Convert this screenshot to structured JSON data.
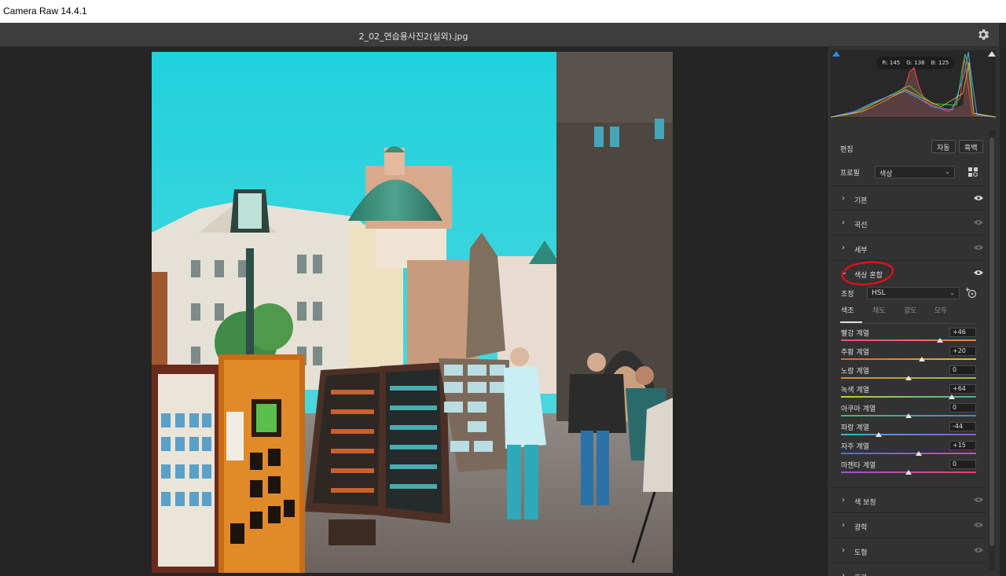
{
  "app": {
    "title": "Camera Raw 14.4.1"
  },
  "document": {
    "filename": "2_02_연습용사진2(실외).jpg"
  },
  "histogram": {
    "r": "R: 145",
    "g": "G: 136",
    "b": "B: 125"
  },
  "edit": {
    "title": "편집",
    "auto_label": "자동",
    "bw_label": "흑백",
    "profile_label": "프로필",
    "profile_value": "색상"
  },
  "sections": {
    "basic": "기본",
    "curve": "곡선",
    "detail": "세부",
    "color_mixer": "색상 혼합",
    "color_grading": "색 보정",
    "optics": "광학",
    "geometry": "도형",
    "effects": "효과"
  },
  "mixer": {
    "adjust_label": "조정",
    "adjust_value": "HSL",
    "tabs": [
      "색조",
      "채도",
      "광도",
      "모두"
    ],
    "active_tab": 0,
    "sliders": [
      {
        "label": "빨강 계열",
        "value": "+46",
        "level": 46,
        "color_from": "#e14d8c",
        "color_to": "#e58a3c"
      },
      {
        "label": "주황 계열",
        "value": "+20",
        "level": 20,
        "color_from": "#e25a3d",
        "color_to": "#d9c23b"
      },
      {
        "label": "노랑 계열",
        "value": "0",
        "level": 0,
        "color_from": "#d98a2e",
        "color_to": "#8fc23d"
      },
      {
        "label": "녹색 계열",
        "value": "+64",
        "level": 64,
        "color_from": "#c9c93a",
        "color_to": "#35b99a"
      },
      {
        "label": "아쿠아 계열",
        "value": "0",
        "level": 0,
        "color_from": "#3fbf62",
        "color_to": "#3a8ad6"
      },
      {
        "label": "파랑 계열",
        "value": "-44",
        "level": -44,
        "color_from": "#36b6c6",
        "color_to": "#8a56d6"
      },
      {
        "label": "자주 계열",
        "value": "+15",
        "level": 15,
        "color_from": "#4a6ed8",
        "color_to": "#cc4fb4"
      },
      {
        "label": "마젠타 계열",
        "value": "0",
        "level": 0,
        "color_from": "#a24fd8",
        "color_to": "#e2466c"
      }
    ]
  },
  "annotation_color": "#e0101a",
  "icons": [
    "gear-icon",
    "eye-icon",
    "chevron-right-icon",
    "chevron-down-icon",
    "presets-grid-icon",
    "target-adjust-icon"
  ]
}
